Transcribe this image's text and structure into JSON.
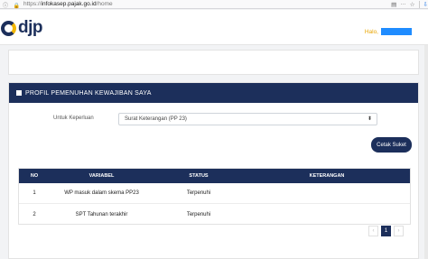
{
  "browser": {
    "url_prefix": "https://",
    "url_host": "infokasep.pajak.go.id",
    "url_path": "/home",
    "left_icons": "ⓘ 🔒",
    "right_icons": [
      "▤",
      "···",
      "☆"
    ],
    "download_icon": "⇩"
  },
  "header": {
    "logo_text": "djp",
    "greeting": "Halo,"
  },
  "card": {
    "title": "PROFIL PEMENUHAN KEWAJIBAN SAYA",
    "form_label": "Untuk Keperluan",
    "select_value": "Surat Keterangan (PP 23)",
    "select_arrow": "⬍",
    "print_button": "Cetak Suket"
  },
  "table": {
    "headers": {
      "no": "NO",
      "variabel": "VARIABEL",
      "status": "STATUS",
      "keterangan": "KETERANGAN"
    },
    "rows": [
      {
        "no": "1",
        "variabel": "WP masuk dalam skema PP23",
        "status": "Terpenuhi",
        "keterangan": ""
      },
      {
        "no": "2",
        "variabel": "SPT Tahunan terakhir",
        "status": "Terpenuhi",
        "keterangan": ""
      }
    ]
  },
  "pagination": {
    "prev": "‹",
    "current": "1",
    "next": "›"
  },
  "colors": {
    "navy": "#1c2f5b",
    "accent": "#f2b705",
    "user_box": "#1f8cff"
  }
}
